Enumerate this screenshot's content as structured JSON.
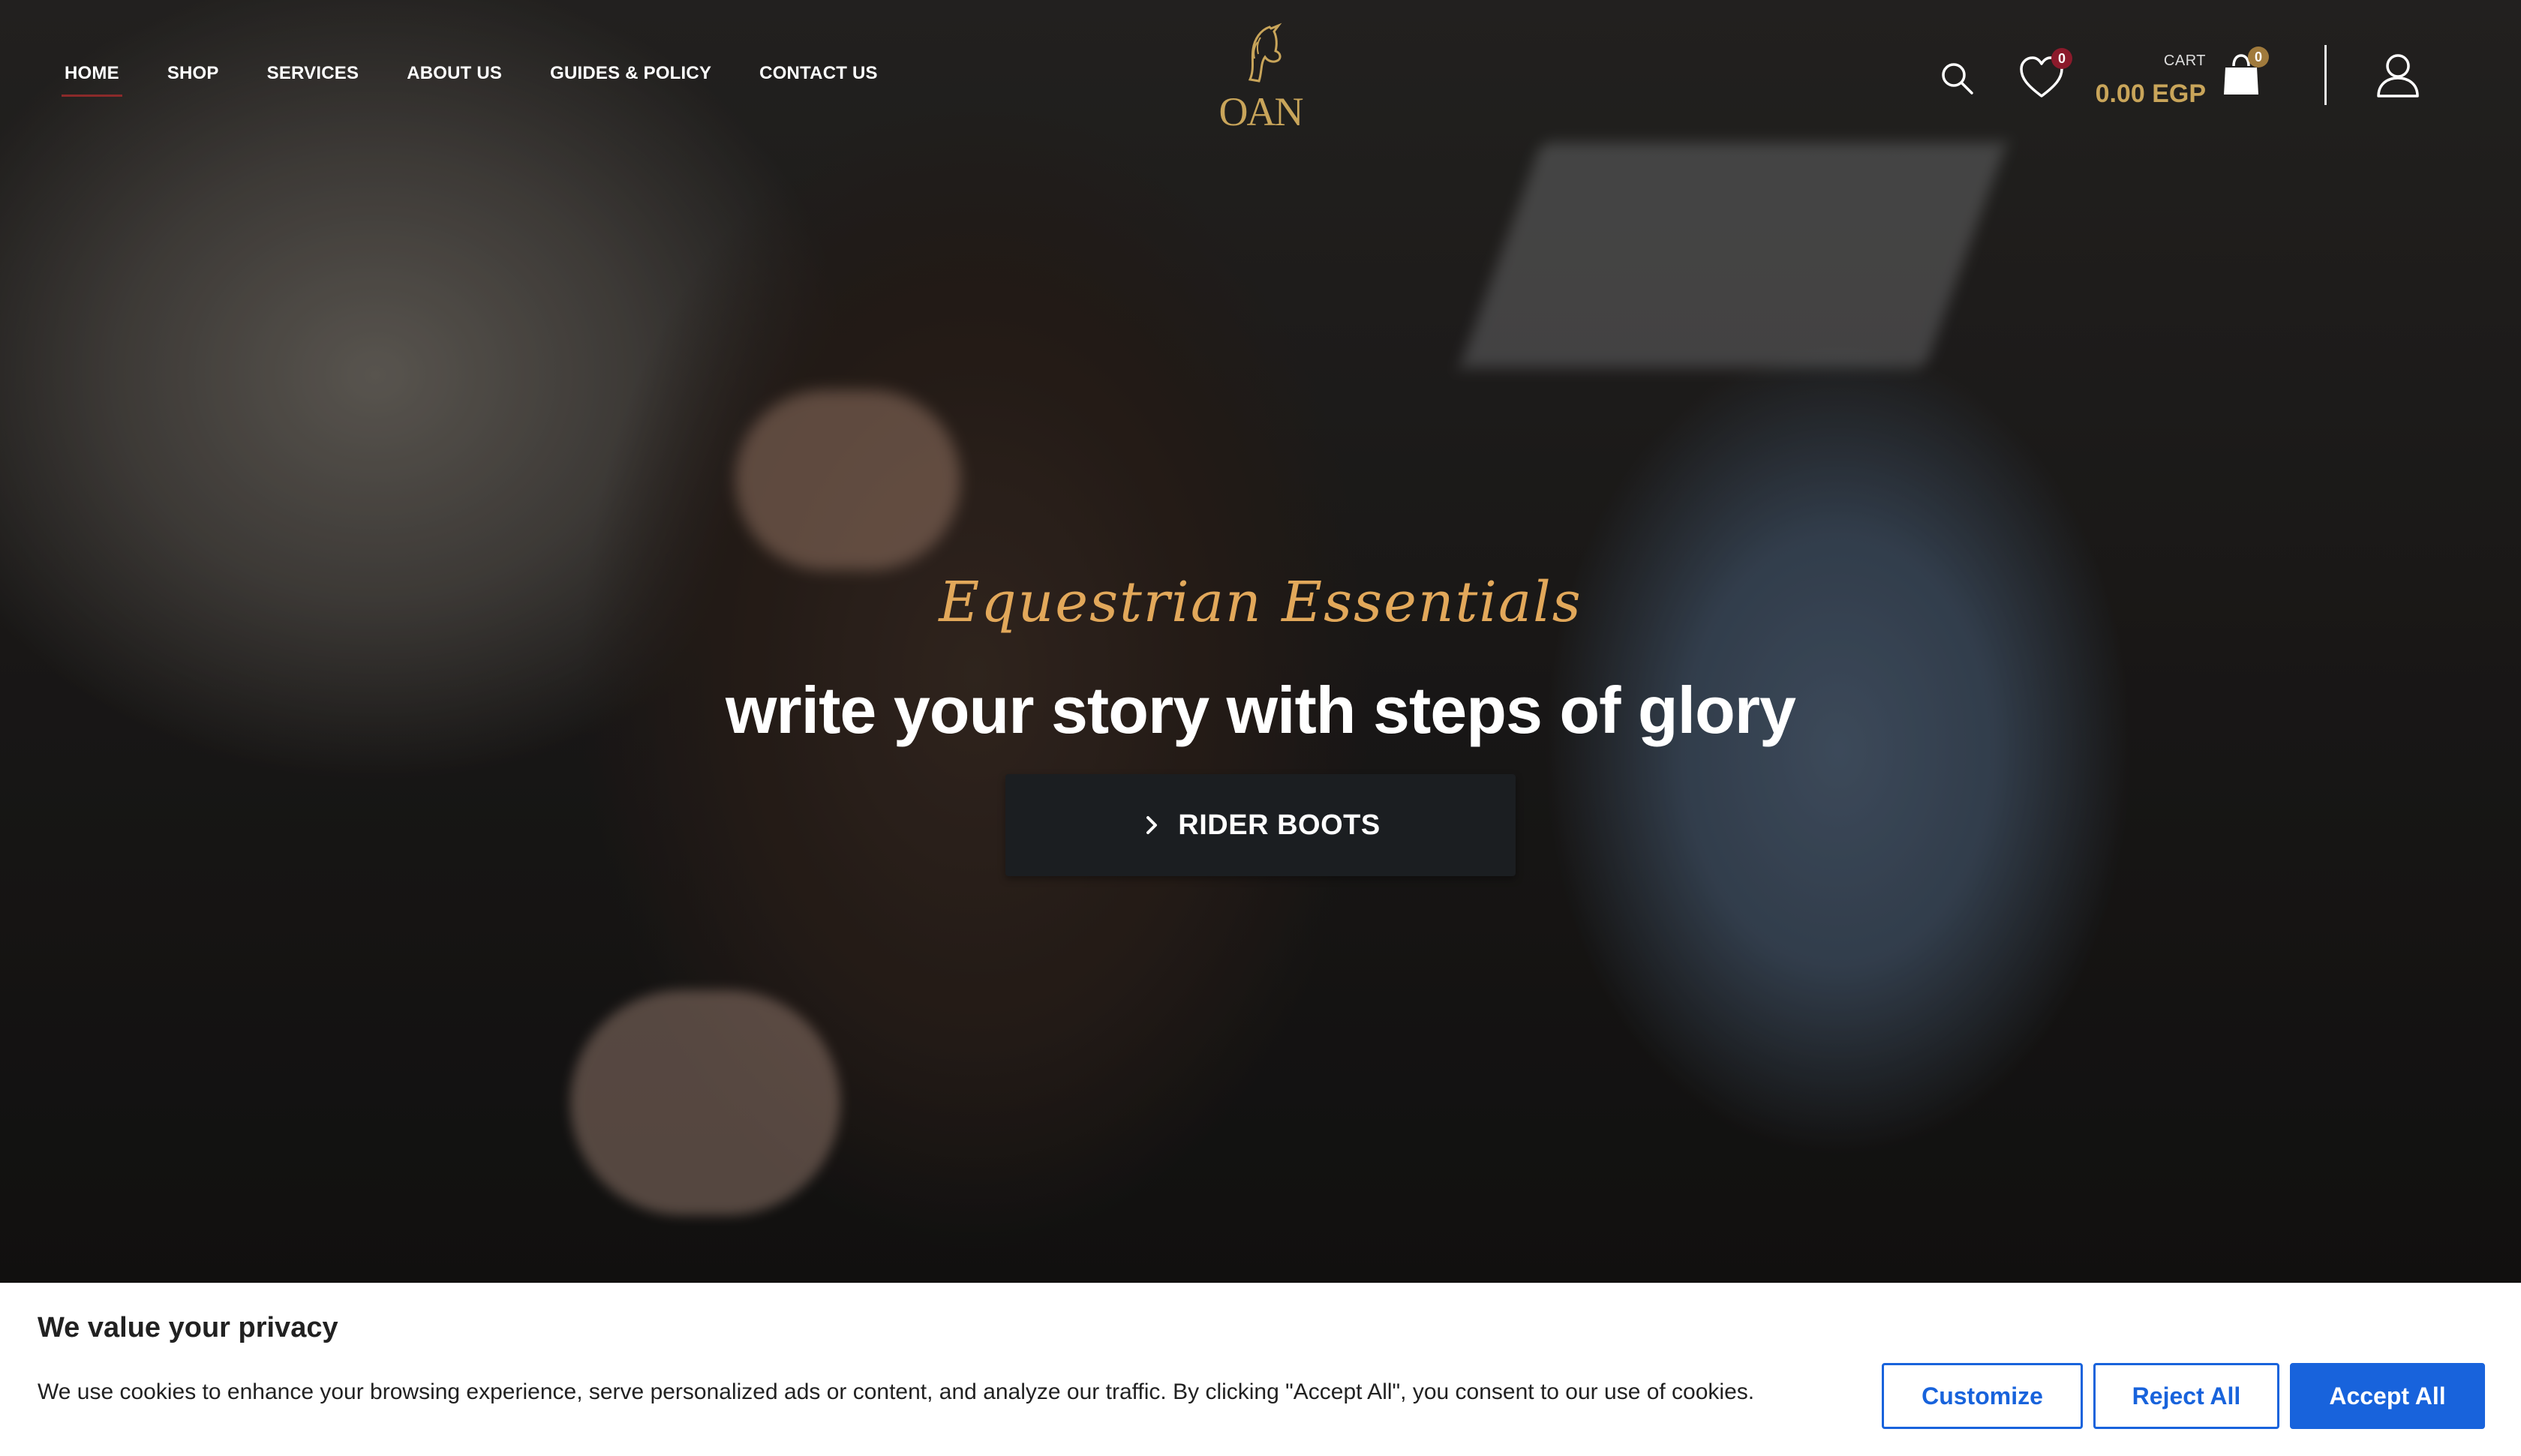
{
  "nav": {
    "links": [
      {
        "label": "HOME",
        "active": true
      },
      {
        "label": "SHOP"
      },
      {
        "label": "SERVICES"
      },
      {
        "label": "ABOUT US"
      },
      {
        "label": "GUIDES & POLICY"
      },
      {
        "label": "CONTACT US"
      }
    ],
    "logo_text": "OAN",
    "wishlist_count": "0",
    "cart_label": "CART",
    "cart_total": "0.00 EGP",
    "cart_count": "0",
    "icons": [
      "search-icon",
      "heart-icon",
      "shopping-bag-icon",
      "user-icon"
    ]
  },
  "hero": {
    "tagline": "Equestrian Essentials",
    "headline": "write your story with steps of glory",
    "cta_label": "RIDER BOOTS"
  },
  "cookie": {
    "title": "We value your privacy",
    "text": "We use cookies to enhance your browsing experience, serve personalized ads or content, and analyze our traffic. By clicking \"Accept All\", you consent to our use of cookies.",
    "customize_label": "Customize",
    "reject_label": "Reject All",
    "accept_label": "Accept All"
  },
  "colors": {
    "accent_gold": "#c9a55a",
    "tagline_gold": "#e2a85a",
    "badge_red": "#8b1a2b",
    "badge_gold": "#a07a3c",
    "cookie_blue": "#1863dc"
  }
}
